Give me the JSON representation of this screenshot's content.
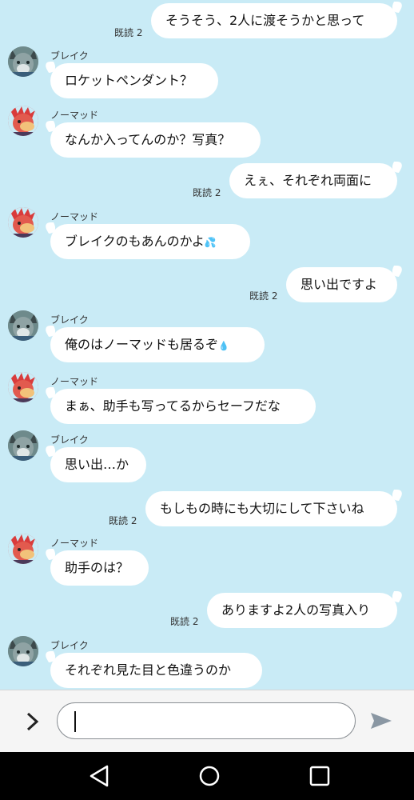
{
  "read_label": "既読 2",
  "messages": [
    {
      "dir": "out",
      "text": "そうそう、2人に渡そうかと思って"
    },
    {
      "dir": "in",
      "sender": "ブレイク",
      "text": "ロケットペンダント？"
    },
    {
      "dir": "in",
      "sender": "ノーマッド",
      "text": "なんか入ってんのか？写真？"
    },
    {
      "dir": "out",
      "text": "えぇ、それぞれ両面に"
    },
    {
      "dir": "in",
      "sender": "ノーマッド",
      "text": "ブレイクのもあんのかよ",
      "emoji": "💦"
    },
    {
      "dir": "out",
      "text": "思い出ですよ"
    },
    {
      "dir": "in",
      "sender": "ブレイク",
      "text": "俺のはノーマッドも居るぞ",
      "emoji": "💧"
    },
    {
      "dir": "in",
      "sender": "ノーマッド",
      "text": "まぁ、助手も写ってるからセーフだな"
    },
    {
      "dir": "in",
      "sender": "ブレイク",
      "text": "思い出…か"
    },
    {
      "dir": "out",
      "text": "もしもの時にも大切にして下さいね"
    },
    {
      "dir": "in",
      "sender": "ノーマッド",
      "text": "助手のは？"
    },
    {
      "dir": "out",
      "text": "ありますよ2人の写真入り"
    },
    {
      "dir": "in",
      "sender": "ブレイク",
      "text": "それぞれ見た目と色違うのか"
    }
  ],
  "input": {
    "value": "",
    "placeholder": ""
  },
  "colors": {
    "background": "#c9ebf6",
    "bubble": "#ffffff",
    "send_icon": "#8a97a3"
  }
}
